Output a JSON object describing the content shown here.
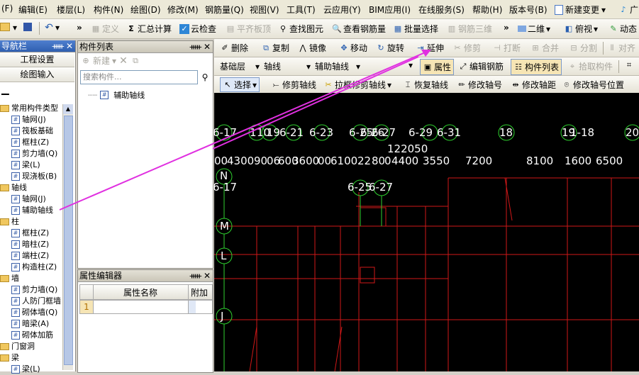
{
  "menubar": {
    "items": [
      "(F)",
      "编辑(E)",
      "楼层(L)",
      "构件(N)",
      "绘图(D)",
      "修改(M)",
      "钢筋量(Q)",
      "视图(V)",
      "工具(T)",
      "云应用(Y)",
      "BIM应用(I)",
      "在线服务(S)",
      "帮助(H)",
      "版本号(B)",
      "新建变更",
      "广"
    ]
  },
  "toolbar1": {
    "define": "定义",
    "sum_calc": "汇总计算",
    "cloud_check": "云检查",
    "flush_slab": "平齐板顶",
    "find_element": "查找图元",
    "view_rebar": "查看钢筋量",
    "batch_select": "批量选择",
    "rebar_3d": "钢筋三维",
    "view_2d": "二维",
    "view_top": "俯视",
    "dynamic": "动态"
  },
  "toolbar2": {
    "delete": "删除",
    "copy": "复制",
    "mirror": "镜像",
    "move": "移动",
    "rotate": "旋转",
    "extend": "延伸",
    "trim": "修剪",
    "break": "打断",
    "merge": "合并",
    "split": "分割",
    "align": "对齐"
  },
  "toolbar3": {
    "layer": "基础层",
    "category": "轴线",
    "type": "辅助轴线",
    "empty": "",
    "properties": "属性",
    "edit_rebar": "编辑钢筋",
    "component_list": "构件列表",
    "pick_component": "拾取构件"
  },
  "toolbar4": {
    "select": "选择",
    "trim_axis": "修剪轴线",
    "drag_trim_axis": "拉框修剪轴线",
    "restore_axis": "恢复轴线",
    "modify_axis_no": "修改轴号",
    "modify_axis_dist": "修改轴距",
    "modify_axis_pos": "修改轴号位置"
  },
  "nav": {
    "title": "导航栏",
    "btn_project": "工程设置",
    "btn_draw": "绘图输入",
    "tree": [
      {
        "type": "folder",
        "label": "常用构件类型"
      },
      {
        "type": "item",
        "label": "轴网(J)"
      },
      {
        "type": "item",
        "label": "筏板基础"
      },
      {
        "type": "item",
        "label": "框柱(Z)"
      },
      {
        "type": "item",
        "label": "剪力墙(Q)"
      },
      {
        "type": "item",
        "label": "梁(L)"
      },
      {
        "type": "item",
        "label": "现浇板(B)"
      },
      {
        "type": "folder",
        "label": "轴线"
      },
      {
        "type": "item",
        "label": "轴网(J)"
      },
      {
        "type": "item",
        "label": "辅助轴线"
      },
      {
        "type": "folder",
        "label": "柱"
      },
      {
        "type": "item",
        "label": "框柱(Z)"
      },
      {
        "type": "item",
        "label": "暗柱(Z)"
      },
      {
        "type": "item",
        "label": "端柱(Z)"
      },
      {
        "type": "item",
        "label": "构造柱(Z)"
      },
      {
        "type": "folder",
        "label": "墙"
      },
      {
        "type": "item",
        "label": "剪力墙(Q)"
      },
      {
        "type": "item",
        "label": "人防门框墙"
      },
      {
        "type": "item",
        "label": "砌体墙(Q)"
      },
      {
        "type": "item",
        "label": "暗梁(A)"
      },
      {
        "type": "item",
        "label": "砌体加筋"
      },
      {
        "type": "folder",
        "label": "门窗洞"
      },
      {
        "type": "folder",
        "label": "梁"
      },
      {
        "type": "item",
        "label": "梁(L)"
      }
    ]
  },
  "complist": {
    "title": "构件列表",
    "new_btn": "新建",
    "search_placeholder": "搜索构件...",
    "item": "辅助轴线"
  },
  "propedit": {
    "title": "属性编辑器",
    "col_name": "属性名称",
    "col_extra": "附加",
    "row_index": "1"
  },
  "canvas": {
    "axis_top": [
      "6-17",
      "1",
      "10",
      "19",
      "6-21",
      "6-23",
      "6-25",
      "6-26",
      "6-27",
      "6-29",
      "6-31",
      "18",
      "19",
      "1-18",
      "20"
    ],
    "dim_top": "122050",
    "dims": [
      "00",
      "4300",
      "90",
      "06",
      "600",
      "3600",
      "00",
      "6100",
      "22",
      "80",
      "0",
      "4400",
      "3550",
      "7200",
      "8100",
      "1600",
      "6500"
    ],
    "axis_lower": [
      "6-17",
      "6-25",
      "6-27"
    ],
    "axis_left": [
      "N",
      "M",
      "L",
      "J"
    ]
  }
}
